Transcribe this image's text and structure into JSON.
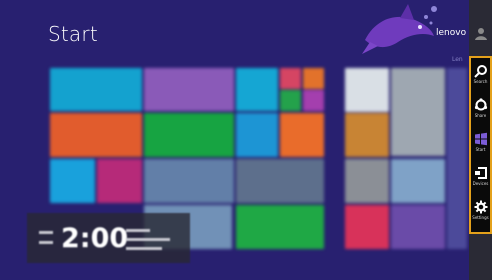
{
  "header": {
    "title": "Start",
    "user_name": "lenovo"
  },
  "group_label": "Len",
  "clock": {
    "time": "2:00"
  },
  "charms": [
    {
      "label": "Search",
      "icon": "search-icon"
    },
    {
      "label": "Share",
      "icon": "share-icon"
    },
    {
      "label": "Start",
      "icon": "windows-logo-icon"
    },
    {
      "label": "Devices",
      "icon": "devices-icon"
    },
    {
      "label": "Settings",
      "icon": "gear-icon"
    }
  ],
  "colors": {
    "background": "#282070",
    "charm_bar": "#0a0a0a",
    "highlight": "#e4a11b"
  }
}
